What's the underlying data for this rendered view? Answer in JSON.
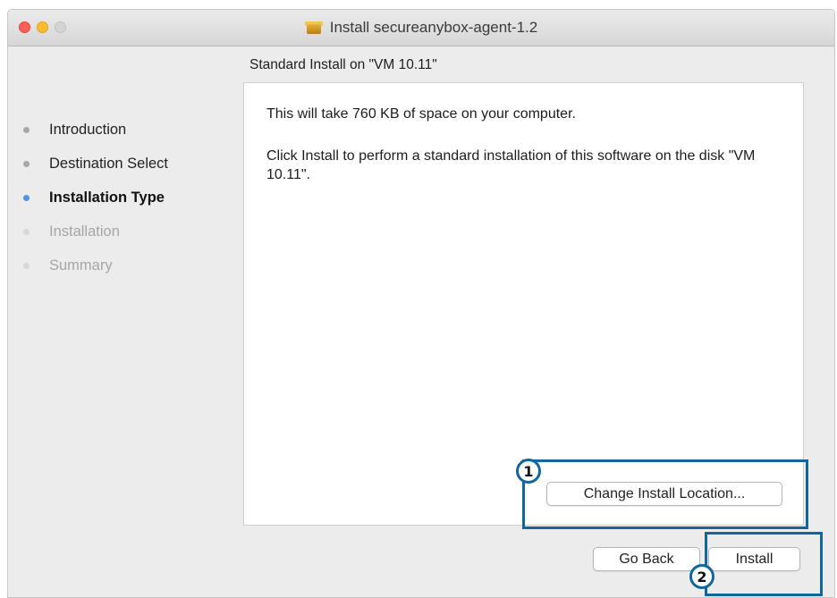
{
  "window": {
    "title": "Install secureanybox-agent-1.2"
  },
  "subtitle": "Standard Install on \"VM 10.11\"",
  "steps": [
    {
      "label": "Introduction",
      "state": "done"
    },
    {
      "label": "Destination Select",
      "state": "done"
    },
    {
      "label": "Installation Type",
      "state": "current"
    },
    {
      "label": "Installation",
      "state": "future"
    },
    {
      "label": "Summary",
      "state": "future"
    }
  ],
  "content": {
    "space_text": "This will take 760 KB of space on your computer.",
    "install_text": "Click Install to perform a standard installation of this software on the disk \"VM 10.11\"."
  },
  "buttons": {
    "change_location": "Change Install Location...",
    "go_back": "Go Back",
    "install": "Install"
  },
  "annotations": {
    "callout_1": "1",
    "callout_2": "2",
    "color": "#12669c"
  },
  "icons": {
    "title_icon": "package-icon"
  },
  "colors": {
    "current_step_dot": "#4d96e0",
    "close": "#fc5f57",
    "minimize": "#fdbc2e"
  }
}
